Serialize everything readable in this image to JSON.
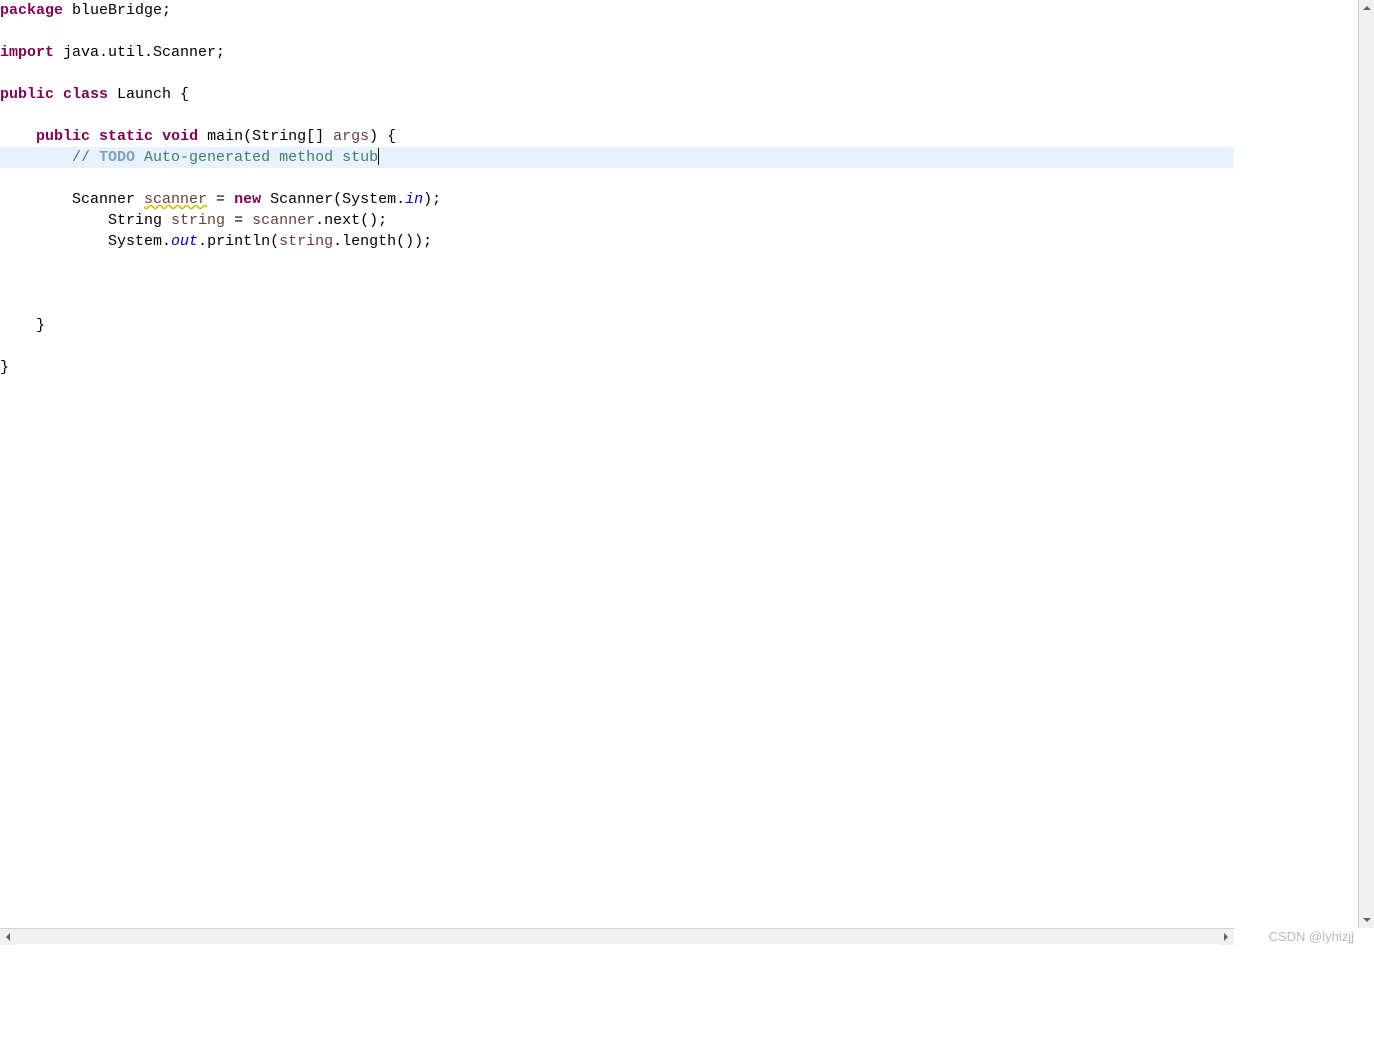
{
  "code": {
    "line1": {
      "kw_package": "package",
      "pkg_name": " blueBridge;"
    },
    "line3": {
      "kw_import": "import",
      "import_name": " java.util.Scanner;"
    },
    "line5": {
      "kw_public": "public",
      "kw_class": "class",
      "class_name": " Launch {"
    },
    "line7": {
      "kw_public": "public",
      "kw_static": "static",
      "kw_void": "void",
      "method_sig": " main(String[] ",
      "args": "args",
      "method_end": ") {"
    },
    "line8": {
      "comment_start": "// ",
      "todo": "TODO",
      "comment_rest": " Auto-generated method stub"
    },
    "line10": {
      "type": "Scanner ",
      "varname": "scanner",
      "assign": " = ",
      "kw_new": "new",
      "ctor": " Scanner(System.",
      "in": "in",
      "end": ");"
    },
    "line11": {
      "type": "String ",
      "varname": "string",
      "assign": " = ",
      "scanner_ref": "scanner",
      "call": ".next();"
    },
    "line12": {
      "sys": "System.",
      "out": "out",
      "print": ".println(",
      "string_ref": "string",
      "call": ".length());"
    },
    "line16": {
      "brace": "    }"
    },
    "line18": {
      "brace": "}"
    }
  },
  "watermark": "CSDN @lyhizjj"
}
